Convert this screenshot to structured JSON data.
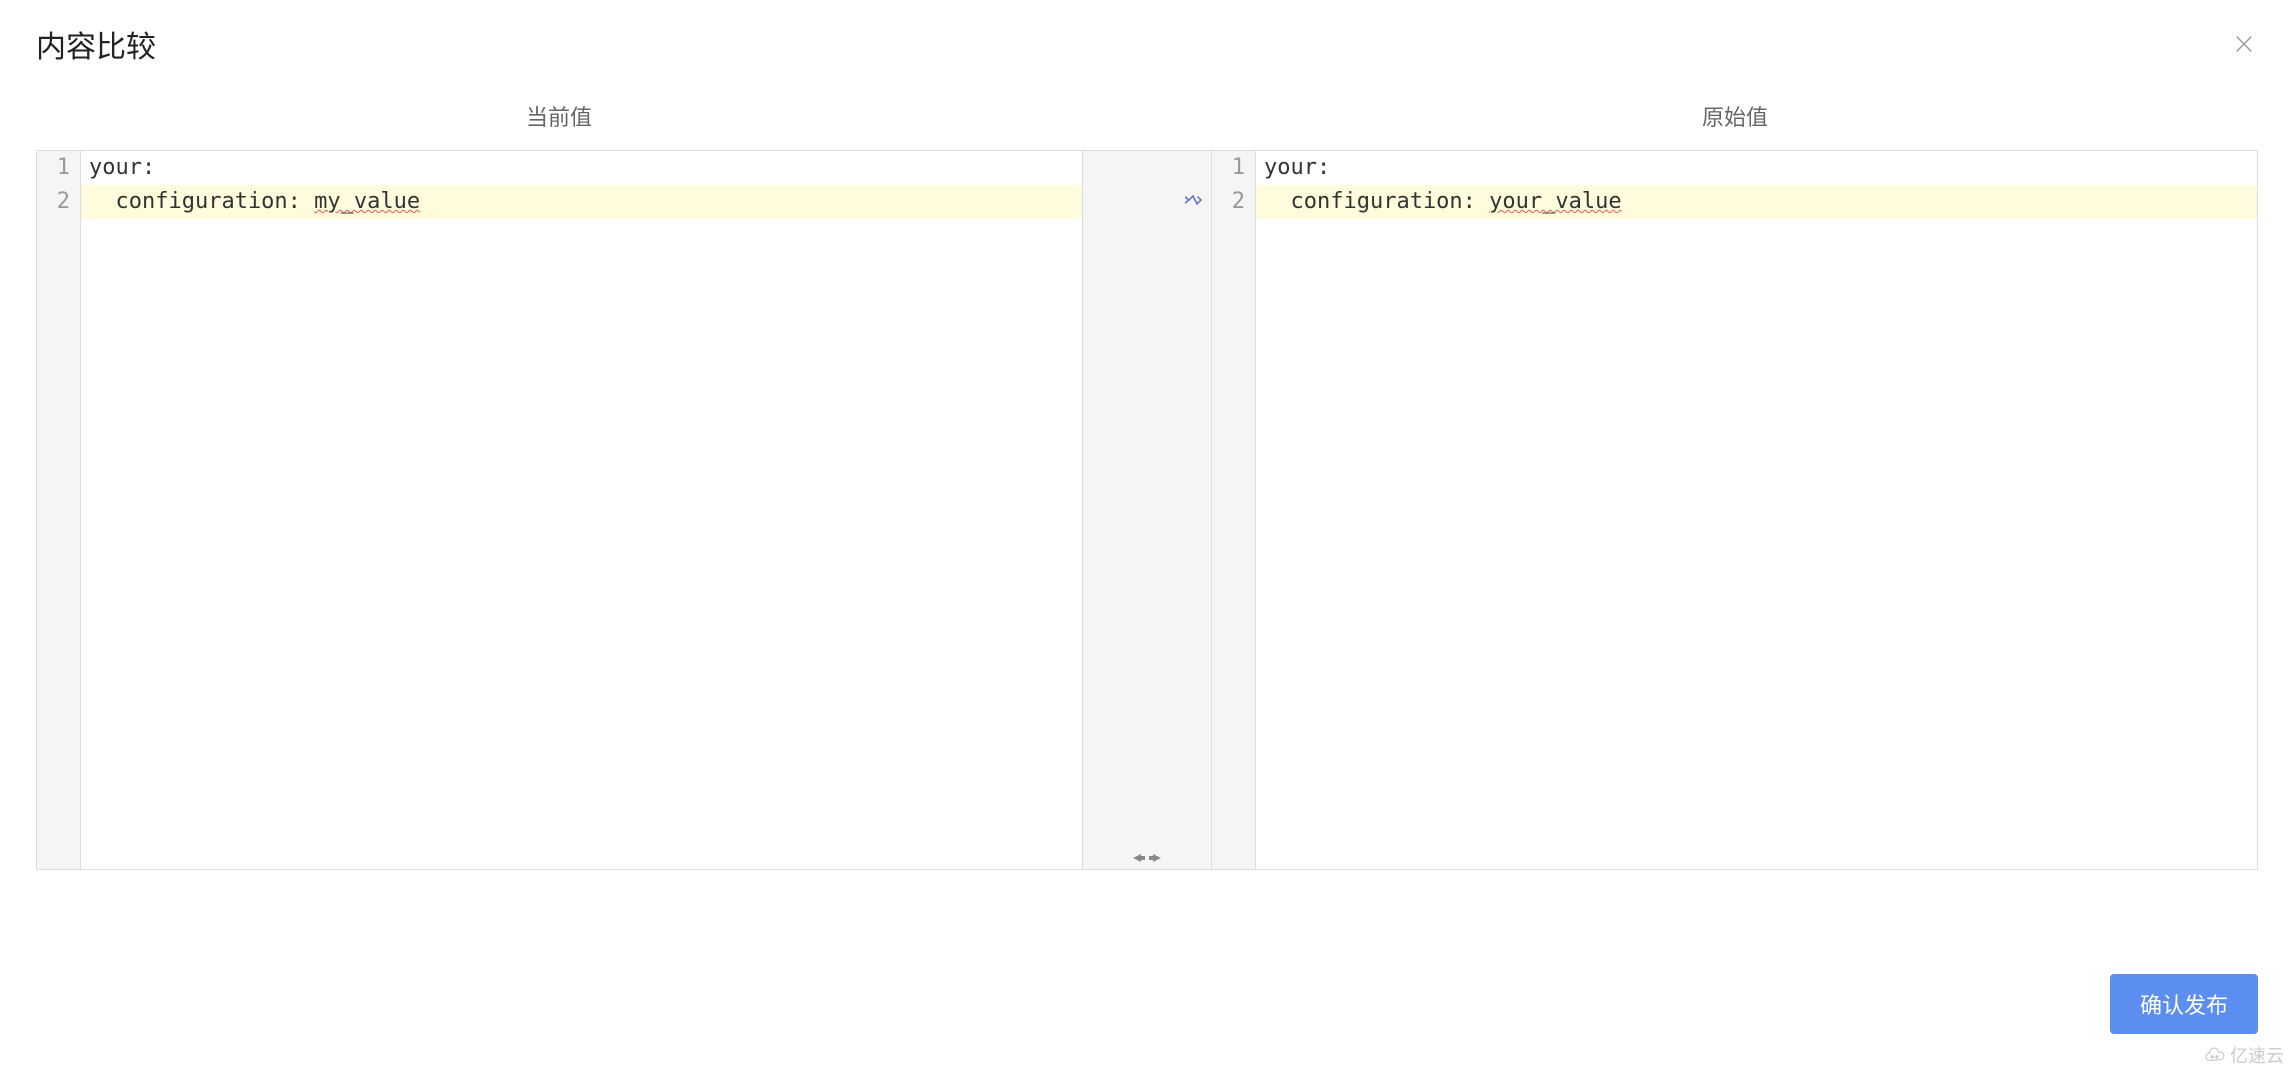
{
  "modal": {
    "title": "内容比较"
  },
  "compare": {
    "left_label": "当前值",
    "right_label": "原始值"
  },
  "left_pane": {
    "lines": [
      {
        "num": "1",
        "text": "your:",
        "changed": false
      },
      {
        "num": "2",
        "text": "  configuration: my_value",
        "changed": true,
        "spell_start": 17,
        "spell_end": 25
      }
    ]
  },
  "right_pane": {
    "lines": [
      {
        "num": "1",
        "text": "your:",
        "changed": false
      },
      {
        "num": "2",
        "text": "  configuration: your_value",
        "changed": true,
        "spell_start": 17,
        "spell_end": 27
      }
    ]
  },
  "footer": {
    "confirm_label": "确认发布"
  },
  "watermark": {
    "text": "亿速云"
  }
}
